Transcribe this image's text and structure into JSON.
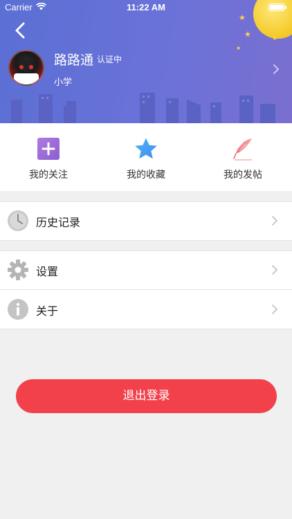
{
  "status_bar": {
    "carrier": "Carrier",
    "time": "11:22 AM"
  },
  "profile": {
    "name": "路路通",
    "badge": "认证中",
    "school": "小学"
  },
  "quick_actions": [
    {
      "label": "我的关注",
      "icon": "plus-icon",
      "color": "#9b6fd6"
    },
    {
      "label": "我的收藏",
      "icon": "star-icon",
      "color": "#3f9df2"
    },
    {
      "label": "我的发帖",
      "icon": "feather-icon",
      "color": "#f07a7a"
    }
  ],
  "menu": [
    {
      "label": "历史记录",
      "icon": "clock-icon"
    },
    {
      "label": "设置",
      "icon": "gear-icon"
    },
    {
      "label": "关于",
      "icon": "info-icon"
    }
  ],
  "logout_label": "退出登录",
  "colors": {
    "header_start": "#5b6fd4",
    "logout": "#f2414b",
    "page_bg": "#f0f0f0"
  }
}
